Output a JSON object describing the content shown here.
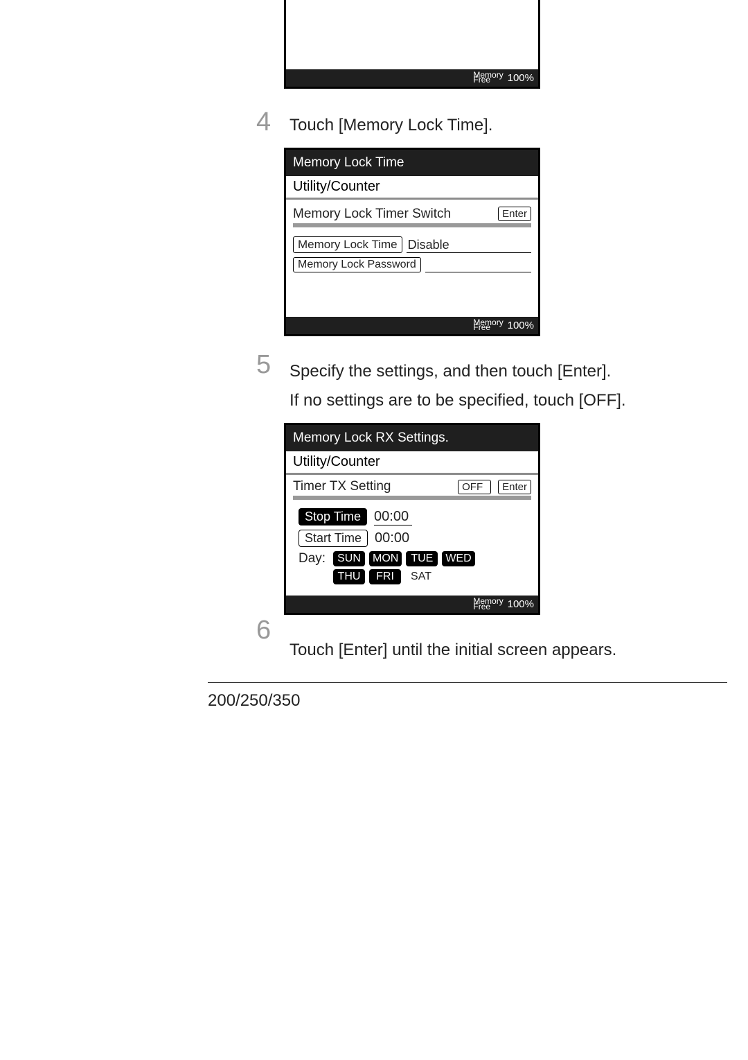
{
  "mem_label_top": "Memory",
  "mem_label_bot": "Free",
  "mem_pct": "100%",
  "step4": {
    "num": "4",
    "text": "Touch [Memory Lock Time].",
    "panel": {
      "title": "Memory Lock Time",
      "breadcrumb": "Utility/Counter",
      "timer_switch_label": "Memory Lock Timer Switch",
      "enter_btn": "Enter",
      "lock_time_btn": "Memory Lock Time",
      "lock_time_val": "Disable",
      "lock_pwd_btn": "Memory Lock Password"
    }
  },
  "step5": {
    "num": "5",
    "line1": "Specify the settings, and then touch [Enter].",
    "line2": "If no settings are to be specified, touch [OFF].",
    "panel": {
      "title": "Memory Lock RX Settings.",
      "breadcrumb": "Utility/Counter",
      "timer_tx_label": "Timer TX Setting",
      "off_btn": "OFF",
      "enter_btn": "Enter",
      "stop_time_label": "Stop Time",
      "stop_time_val": "00:00",
      "start_time_label": "Start Time",
      "start_time_val": "00:00",
      "day_label": "Day:",
      "days": [
        "SUN",
        "MON",
        "TUE",
        "WED",
        "THU",
        "FRI",
        "SAT"
      ],
      "days_selected": [
        "SUN",
        "MON",
        "TUE",
        "WED",
        "THU",
        "FRI"
      ]
    }
  },
  "step6": {
    "num": "6",
    "text": "Touch [Enter] until the initial screen appears."
  },
  "footer_model": "200/250/350"
}
